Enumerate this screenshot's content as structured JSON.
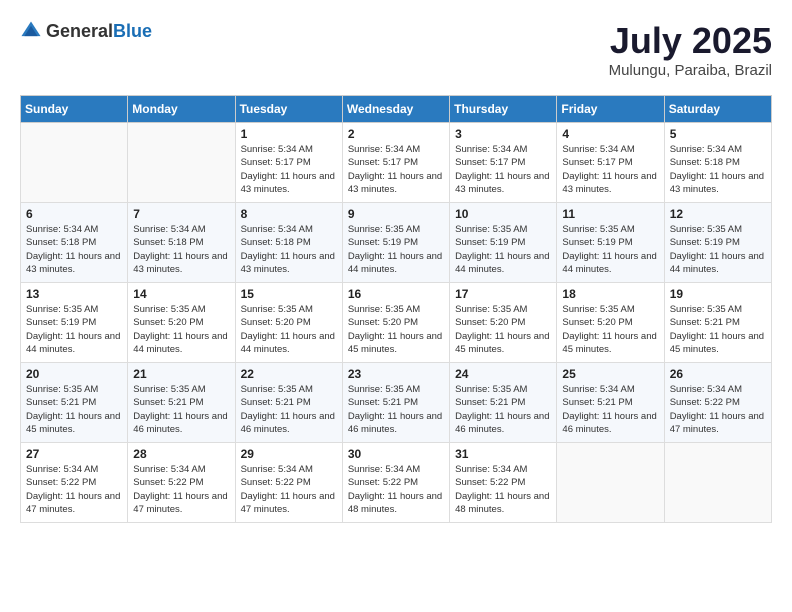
{
  "logo": {
    "general": "General",
    "blue": "Blue"
  },
  "header": {
    "month": "July 2025",
    "location": "Mulungu, Paraiba, Brazil"
  },
  "weekdays": [
    "Sunday",
    "Monday",
    "Tuesday",
    "Wednesday",
    "Thursday",
    "Friday",
    "Saturday"
  ],
  "weeks": [
    [
      {
        "day": "",
        "detail": ""
      },
      {
        "day": "",
        "detail": ""
      },
      {
        "day": "1",
        "detail": "Sunrise: 5:34 AM\nSunset: 5:17 PM\nDaylight: 11 hours and 43 minutes."
      },
      {
        "day": "2",
        "detail": "Sunrise: 5:34 AM\nSunset: 5:17 PM\nDaylight: 11 hours and 43 minutes."
      },
      {
        "day": "3",
        "detail": "Sunrise: 5:34 AM\nSunset: 5:17 PM\nDaylight: 11 hours and 43 minutes."
      },
      {
        "day": "4",
        "detail": "Sunrise: 5:34 AM\nSunset: 5:17 PM\nDaylight: 11 hours and 43 minutes."
      },
      {
        "day": "5",
        "detail": "Sunrise: 5:34 AM\nSunset: 5:18 PM\nDaylight: 11 hours and 43 minutes."
      }
    ],
    [
      {
        "day": "6",
        "detail": "Sunrise: 5:34 AM\nSunset: 5:18 PM\nDaylight: 11 hours and 43 minutes."
      },
      {
        "day": "7",
        "detail": "Sunrise: 5:34 AM\nSunset: 5:18 PM\nDaylight: 11 hours and 43 minutes."
      },
      {
        "day": "8",
        "detail": "Sunrise: 5:34 AM\nSunset: 5:18 PM\nDaylight: 11 hours and 43 minutes."
      },
      {
        "day": "9",
        "detail": "Sunrise: 5:35 AM\nSunset: 5:19 PM\nDaylight: 11 hours and 44 minutes."
      },
      {
        "day": "10",
        "detail": "Sunrise: 5:35 AM\nSunset: 5:19 PM\nDaylight: 11 hours and 44 minutes."
      },
      {
        "day": "11",
        "detail": "Sunrise: 5:35 AM\nSunset: 5:19 PM\nDaylight: 11 hours and 44 minutes."
      },
      {
        "day": "12",
        "detail": "Sunrise: 5:35 AM\nSunset: 5:19 PM\nDaylight: 11 hours and 44 minutes."
      }
    ],
    [
      {
        "day": "13",
        "detail": "Sunrise: 5:35 AM\nSunset: 5:19 PM\nDaylight: 11 hours and 44 minutes."
      },
      {
        "day": "14",
        "detail": "Sunrise: 5:35 AM\nSunset: 5:20 PM\nDaylight: 11 hours and 44 minutes."
      },
      {
        "day": "15",
        "detail": "Sunrise: 5:35 AM\nSunset: 5:20 PM\nDaylight: 11 hours and 44 minutes."
      },
      {
        "day": "16",
        "detail": "Sunrise: 5:35 AM\nSunset: 5:20 PM\nDaylight: 11 hours and 45 minutes."
      },
      {
        "day": "17",
        "detail": "Sunrise: 5:35 AM\nSunset: 5:20 PM\nDaylight: 11 hours and 45 minutes."
      },
      {
        "day": "18",
        "detail": "Sunrise: 5:35 AM\nSunset: 5:20 PM\nDaylight: 11 hours and 45 minutes."
      },
      {
        "day": "19",
        "detail": "Sunrise: 5:35 AM\nSunset: 5:21 PM\nDaylight: 11 hours and 45 minutes."
      }
    ],
    [
      {
        "day": "20",
        "detail": "Sunrise: 5:35 AM\nSunset: 5:21 PM\nDaylight: 11 hours and 45 minutes."
      },
      {
        "day": "21",
        "detail": "Sunrise: 5:35 AM\nSunset: 5:21 PM\nDaylight: 11 hours and 46 minutes."
      },
      {
        "day": "22",
        "detail": "Sunrise: 5:35 AM\nSunset: 5:21 PM\nDaylight: 11 hours and 46 minutes."
      },
      {
        "day": "23",
        "detail": "Sunrise: 5:35 AM\nSunset: 5:21 PM\nDaylight: 11 hours and 46 minutes."
      },
      {
        "day": "24",
        "detail": "Sunrise: 5:35 AM\nSunset: 5:21 PM\nDaylight: 11 hours and 46 minutes."
      },
      {
        "day": "25",
        "detail": "Sunrise: 5:34 AM\nSunset: 5:21 PM\nDaylight: 11 hours and 46 minutes."
      },
      {
        "day": "26",
        "detail": "Sunrise: 5:34 AM\nSunset: 5:22 PM\nDaylight: 11 hours and 47 minutes."
      }
    ],
    [
      {
        "day": "27",
        "detail": "Sunrise: 5:34 AM\nSunset: 5:22 PM\nDaylight: 11 hours and 47 minutes."
      },
      {
        "day": "28",
        "detail": "Sunrise: 5:34 AM\nSunset: 5:22 PM\nDaylight: 11 hours and 47 minutes."
      },
      {
        "day": "29",
        "detail": "Sunrise: 5:34 AM\nSunset: 5:22 PM\nDaylight: 11 hours and 47 minutes."
      },
      {
        "day": "30",
        "detail": "Sunrise: 5:34 AM\nSunset: 5:22 PM\nDaylight: 11 hours and 48 minutes."
      },
      {
        "day": "31",
        "detail": "Sunrise: 5:34 AM\nSunset: 5:22 PM\nDaylight: 11 hours and 48 minutes."
      },
      {
        "day": "",
        "detail": ""
      },
      {
        "day": "",
        "detail": ""
      }
    ]
  ]
}
